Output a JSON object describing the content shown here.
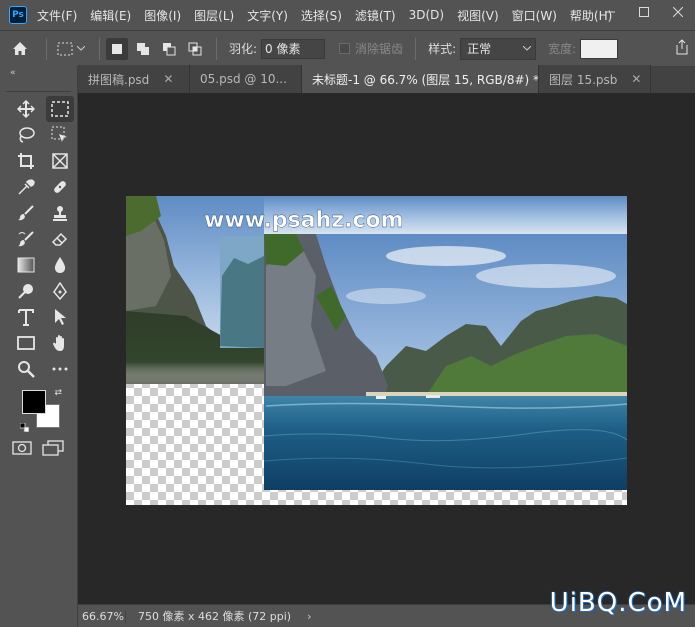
{
  "app": {
    "logo": "Ps",
    "menu": [
      "文件(F)",
      "编辑(E)",
      "图像(I)",
      "图层(L)",
      "文字(Y)",
      "选择(S)",
      "滤镜(T)",
      "3D(D)",
      "视图(V)",
      "窗口(W)",
      "帮助(H)"
    ],
    "window_controls": [
      "minimize-icon",
      "maximize-icon",
      "close-icon"
    ]
  },
  "options": {
    "feather_label": "羽化:",
    "feather_value": "0 像素",
    "antialias_label": "消除锯齿",
    "style_label": "样式:",
    "style_value": "正常",
    "width_label": "宽度:"
  },
  "tabs": [
    {
      "label": "拼图稿.psd",
      "active": false
    },
    {
      "label": "05.psd @ 10...",
      "active": false
    },
    {
      "label": "未标题-1 @ 66.7% (图层 15, RGB/8#) *",
      "active": true
    },
    {
      "label": "图层 15.psb",
      "active": false
    }
  ],
  "canvas": {
    "overlay_text": "www.psahz.com"
  },
  "colors": {
    "foreground": "#000000",
    "background": "#ffffff"
  },
  "status": {
    "zoom": "66.67%",
    "doc_info": "750 像素 x 462 像素 (72 ppi)",
    "arrow": "›"
  },
  "watermark": "UiBQ.CoM"
}
